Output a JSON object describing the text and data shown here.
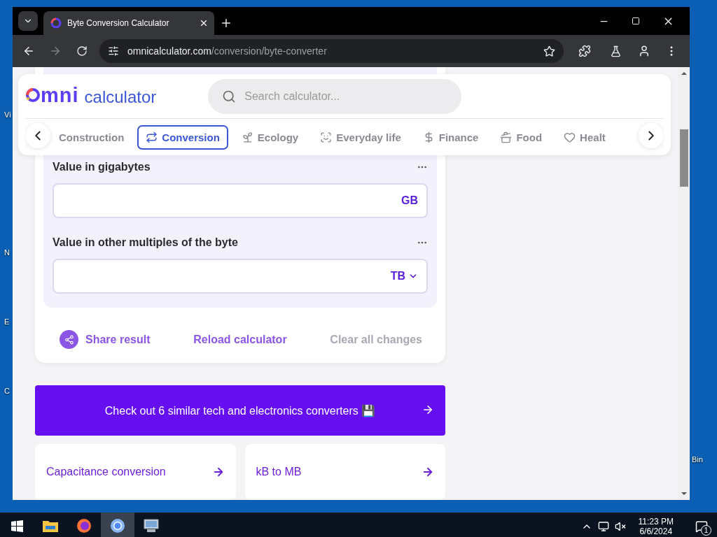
{
  "desktop": {
    "left_labels": [
      "Vi",
      "N",
      "E",
      "C"
    ],
    "right_labels": [
      "Bin"
    ]
  },
  "browser": {
    "tabs": [
      {
        "title": "Byte Conversion Calculator",
        "selected": true
      }
    ],
    "address": {
      "domain": "omnicalculator.com",
      "path": "/conversion/byte-converter"
    }
  },
  "header": {
    "logo": {
      "letters": "mni",
      "word": "calculator"
    },
    "search": {
      "placeholder": "Search calculator..."
    },
    "categories": [
      {
        "label": "Construction",
        "selected": false
      },
      {
        "label": "Conversion",
        "selected": true
      },
      {
        "label": "Ecology",
        "selected": false
      },
      {
        "label": "Everyday life",
        "selected": false
      },
      {
        "label": "Finance",
        "selected": false
      },
      {
        "label": "Food",
        "selected": false
      },
      {
        "label": "Healt",
        "selected": false
      }
    ]
  },
  "calculator": {
    "fields": [
      {
        "label": "Value in gigabytes",
        "unit": "GB",
        "kind": "unit"
      },
      {
        "label": "Value in other multiples of the byte",
        "unit": "TB",
        "kind": "select"
      }
    ],
    "actions": [
      {
        "label": "Share result",
        "kind": "share",
        "disabled": false
      },
      {
        "label": "Reload calculator",
        "kind": "plain",
        "disabled": false
      },
      {
        "label": "Clear all changes",
        "kind": "plain",
        "disabled": true
      }
    ]
  },
  "banner": {
    "text": "Check out 6 similar tech and electronics converters 💾"
  },
  "links": [
    "Capacitance conversion",
    "kB to MB"
  ],
  "taskbar": {
    "apps": [
      {
        "selected": false
      },
      {
        "selected": false
      },
      {
        "selected": false
      },
      {
        "selected": true
      },
      {
        "selected": false
      }
    ],
    "time": "11:23 PM",
    "date": "6/6/2024",
    "notifications": "1"
  }
}
